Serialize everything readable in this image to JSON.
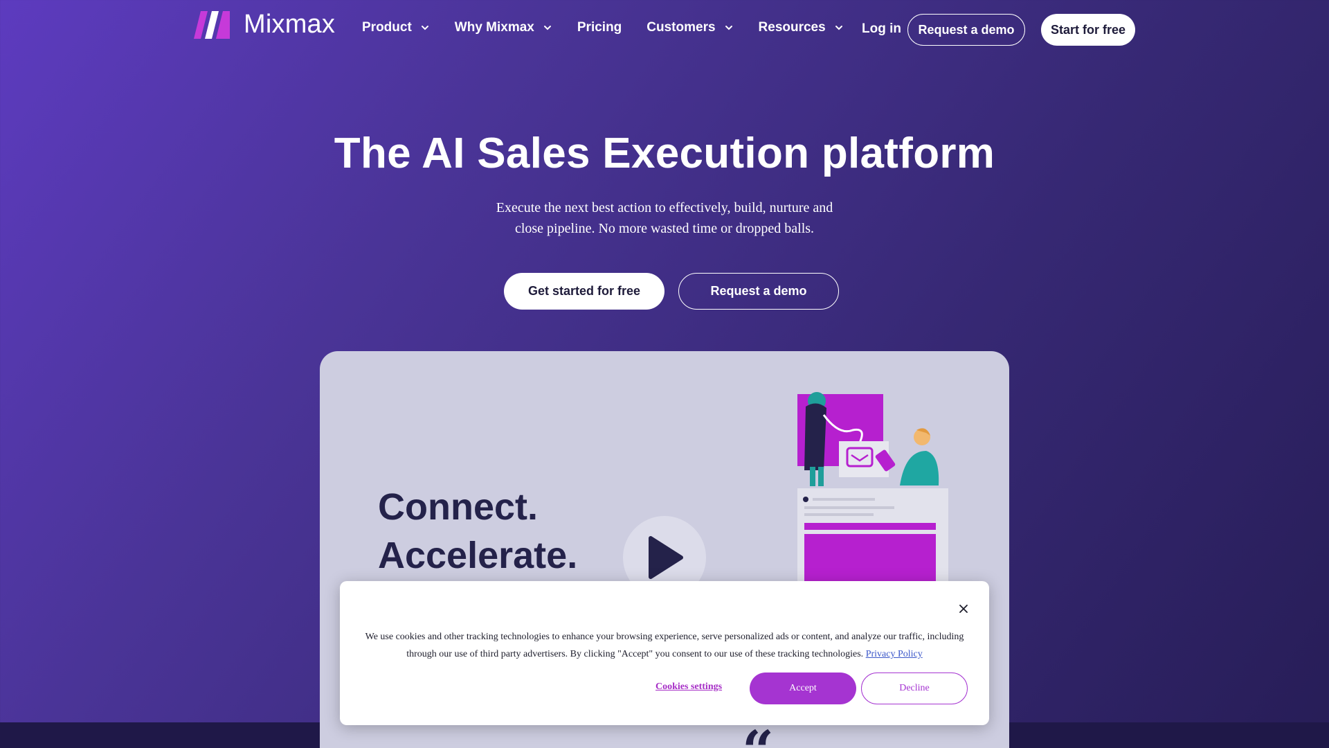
{
  "brand": {
    "name": "Mixmax"
  },
  "nav": {
    "items": [
      {
        "label": "Product",
        "has_dropdown": true
      },
      {
        "label": "Why Mixmax",
        "has_dropdown": true
      },
      {
        "label": "Pricing",
        "has_dropdown": false
      },
      {
        "label": "Customers",
        "has_dropdown": true
      },
      {
        "label": "Resources",
        "has_dropdown": true
      }
    ],
    "login_label": "Log in",
    "demo_label": "Request a demo",
    "start_label": "Start for free"
  },
  "hero": {
    "title": "The AI Sales Execution platform",
    "subtitle_line1": "Execute the next best action to effectively, build, nurture and",
    "subtitle_line2": "close pipeline.  No more wasted time or dropped balls.",
    "cta_primary": "Get started for free",
    "cta_secondary": "Request a demo"
  },
  "video": {
    "line1": "Connect.",
    "line2": "Accelerate.",
    "quote_glyph": "“"
  },
  "cookie_banner": {
    "text": "We use cookies and other tracking technologies to enhance your browsing experience, serve personalized ads or content, and analyze our traffic, including through our use of third party advertisers. By clicking \"Accept\" you consent to our use of these tracking technologies.",
    "privacy_link": "Privacy Policy",
    "settings_label": "Cookies settings",
    "accept_label": "Accept",
    "decline_label": "Decline"
  },
  "colors": {
    "accent_purple": "#a534d1",
    "magenta": "#b620cf",
    "dark_navy": "#24224a"
  }
}
